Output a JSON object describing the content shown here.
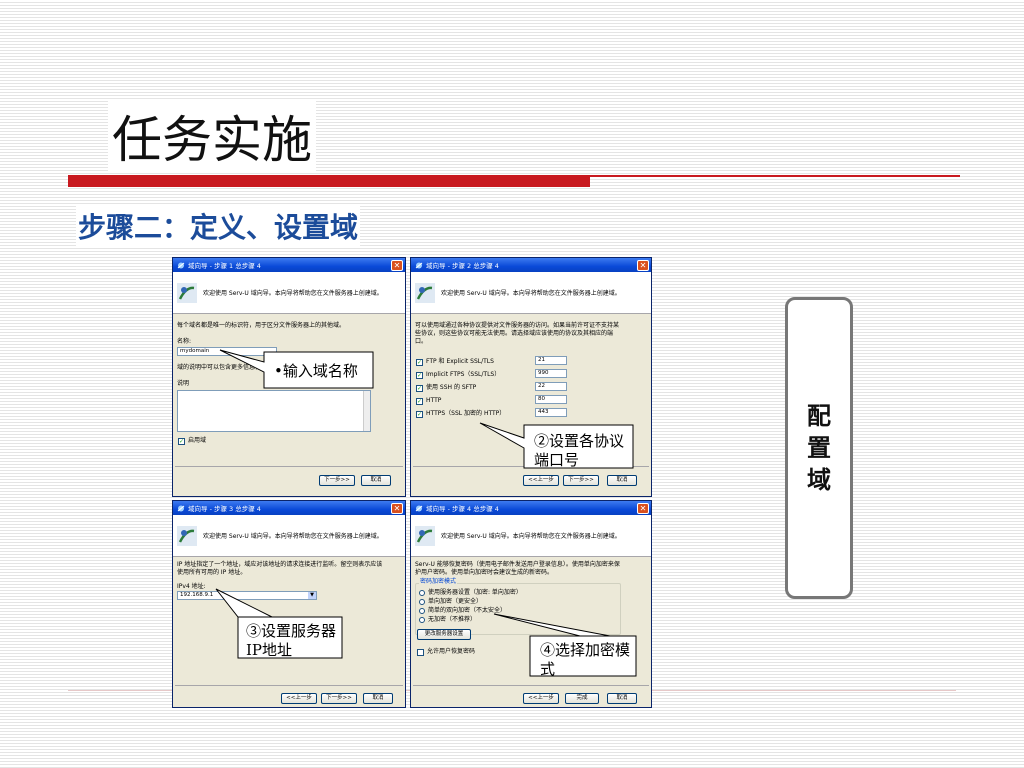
{
  "slide": {
    "title": "任务实施",
    "subtitle": "步骤二：定义、设置域",
    "side_label": "配置域"
  },
  "dialog_common": {
    "welcome": "欢迎使用 Serv-U 域向导。本向导将帮助您在文件服务器上创建域。",
    "close_symbol": "✕",
    "next_btn": "下一步>>",
    "back_btn": "<<上一步",
    "cancel_btn": "取消",
    "finish_btn": "完成"
  },
  "dialog1": {
    "title": "域向导 - 步骤 1 总步骤 4",
    "desc": "每个域名都是唯一的标识符，用于区分文件服务器上的其他域。",
    "name_label": "名称:",
    "name_value": "mydomain",
    "desc_hint": "域的说明中可以包含更多信息，",
    "desc_label": "说明",
    "enable_label": "启用域"
  },
  "dialog2": {
    "title": "域向导 - 步骤 2 总步骤 4",
    "desc_line1": "可以使用域通过各种协议提供对文件服务器的访问。如果当前许可证不支持某",
    "desc_line2": "些协议，则这些协议可能无法使用。请选择域应该使用的协议及其相应的端",
    "desc_line3": "口。",
    "protocols": [
      {
        "label": "FTP 和 Explicit SSL/TLS",
        "port": "21"
      },
      {
        "label": "Implicit FTPS（SSL/TLS）",
        "port": "990"
      },
      {
        "label": "使用 SSH 的 SFTP",
        "port": "22"
      },
      {
        "label": "HTTP",
        "port": "80"
      },
      {
        "label": "HTTPS（SSL 加密的 HTTP）",
        "port": "443"
      }
    ]
  },
  "dialog3": {
    "title": "域向导 - 步骤 3 总步骤 4",
    "desc_line1": "IP 地址指定了一个地址，域应对该地址的请求连接进行监听。留空则表示应该",
    "desc_line2": "使用所有可用的 IP 地址。",
    "ip_label": "IPv4 地址:",
    "ip_value": "192.168.9.1"
  },
  "dialog4": {
    "title": "域向导 - 步骤 4 总步骤 4",
    "desc_line1": "Serv-U 能够恢复密码（使用电子邮件发送用户登录信息）。使用单向加密来保",
    "desc_line2": "护用户密码。使用单向加密时会建议生成的新密码。",
    "group_label": "密码加密模式",
    "options": [
      "使用服务器设置（加密: 单向加密）",
      "单向加密（更安全）",
      "简单的双向加密（不太安全）",
      "无加密（不推荐）"
    ],
    "change_btn": "更改服务器设置",
    "allow_recover": "允许用户恢复密码"
  },
  "callouts": {
    "c1": "•输入域名称",
    "c2": "②设置各协议端口号",
    "c3": "③设置服务器IP地址",
    "c4": "④选择加密模式"
  }
}
